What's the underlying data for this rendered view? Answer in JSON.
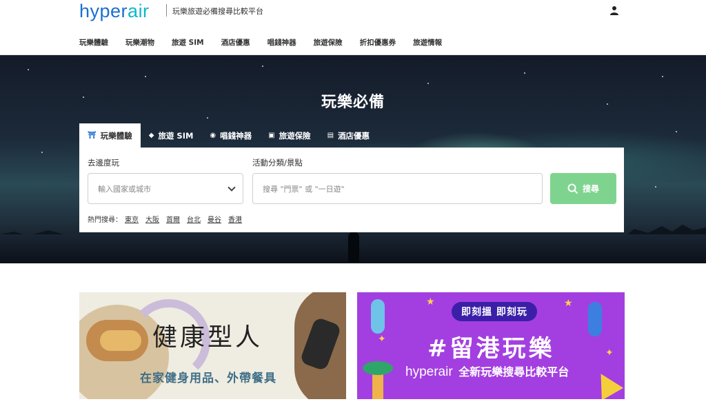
{
  "header": {
    "logo_part1": "hyper",
    "logo_part2": "air",
    "tagline": "玩樂旅遊必備搜尋比較平台",
    "user_icon": "user-icon"
  },
  "nav": {
    "items": [
      "玩樂體驗",
      "玩樂潮物",
      "旅遊 SIM",
      "酒店優惠",
      "唱錢神器",
      "旅遊保險",
      "折扣優惠券",
      "旅遊情報"
    ]
  },
  "hero": {
    "title": "玩樂必備",
    "tabs": [
      {
        "label": "玩樂體驗",
        "icon": "torii-icon",
        "glyph": "⛩"
      },
      {
        "label": "旅遊 SIM",
        "icon": "sim-icon",
        "glyph": "◆"
      },
      {
        "label": "唱錢神器",
        "icon": "exchange-icon",
        "glyph": "◉"
      },
      {
        "label": "旅遊保險",
        "icon": "insurance-icon",
        "glyph": "▣"
      },
      {
        "label": "酒店優惠",
        "icon": "hotel-icon",
        "glyph": "▤"
      }
    ],
    "active_tab": 0
  },
  "search": {
    "destination_label": "去邊度玩",
    "destination_placeholder": "輸入國家或城市",
    "category_label": "活動分類/景點",
    "category_placeholder": "搜尋 \"門票\" 或 \"一日遊\"",
    "button_label": "搜尋",
    "hot_label": "熱門搜尋：",
    "hot_items": [
      "東京",
      "大阪",
      "首爾",
      "台北",
      "曼谷",
      "香港"
    ]
  },
  "banners": {
    "left": {
      "title": "健康型人",
      "subtitle": "在家健身用品、外帶餐具"
    },
    "right": {
      "pill": "即刻搵 即刻玩",
      "headline": "#留港玩樂",
      "brand": "hyperair",
      "tagline": "全新玩樂搜尋比較平台"
    }
  },
  "colors": {
    "brand_blue": "#1a6fd1",
    "brand_cyan": "#10b7c9",
    "search_button": "#7ed48e",
    "promo_purple": "#a33fe0"
  }
}
